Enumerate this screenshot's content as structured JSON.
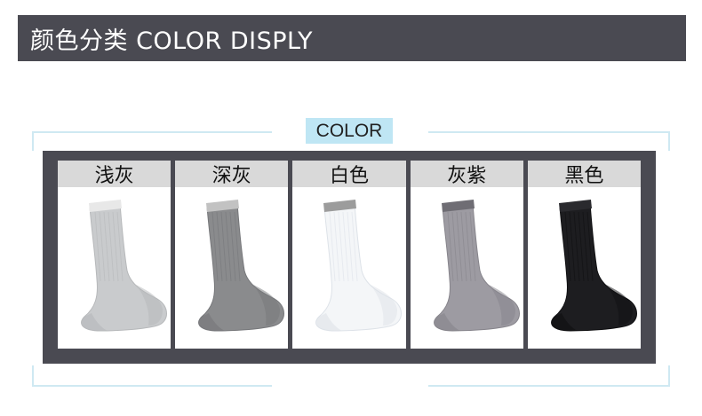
{
  "header": {
    "title": "颜色分类 COLOR DISPLY"
  },
  "section": {
    "tag": "COLOR"
  },
  "colors": [
    {
      "label": "浅灰",
      "icon": "light-gray-sock",
      "body": "#c9cbcd",
      "rim": "#e8e8e8",
      "shade": "#b6b8ba"
    },
    {
      "label": "深灰",
      "icon": "dark-gray-sock",
      "body": "#8a8b8d",
      "rim": "#c2c2c2",
      "shade": "#76777a"
    },
    {
      "label": "白色",
      "icon": "white-sock",
      "body": "#f4f6f8",
      "rim": "#9c9c9c",
      "shade": "#dde2e8"
    },
    {
      "label": "灰紫",
      "icon": "gray-purple-sock",
      "body": "#9d9ba2",
      "rim": "#6f6d74",
      "shade": "#86848b"
    },
    {
      "label": "黑色",
      "icon": "black-sock",
      "body": "#1d1d20",
      "rim": "#2a2a2e",
      "shade": "#0f0f11"
    }
  ]
}
